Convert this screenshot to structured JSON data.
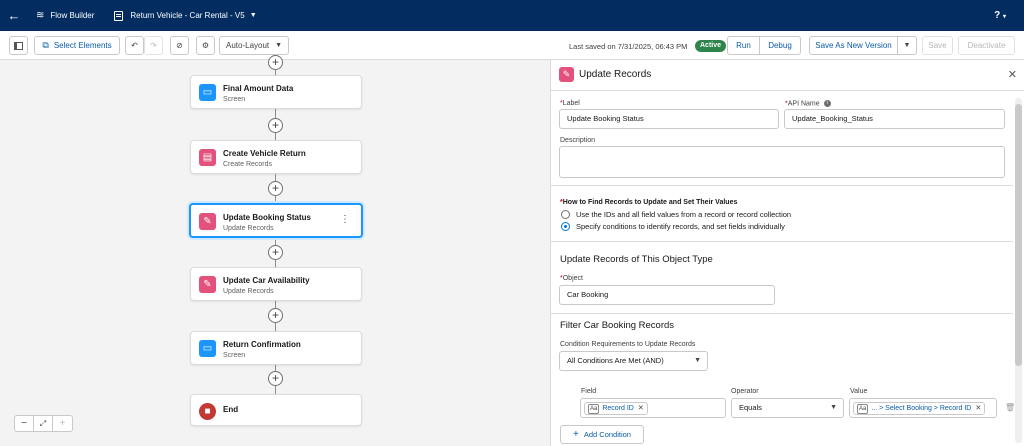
{
  "header": {
    "app_name": "Flow Builder",
    "flow_name": "Return Vehicle - Car Rental - V5",
    "help_label": "?"
  },
  "toolbar": {
    "select_elements": "Select Elements",
    "layout_mode": "Auto-Layout",
    "last_saved": "Last saved on 7/31/2025, 06:43 PM",
    "status_badge": "Active",
    "run": "Run",
    "debug": "Debug",
    "save_as": "Save As New Version",
    "save": "Save",
    "deactivate": "Deactivate"
  },
  "canvas": {
    "nodes": [
      {
        "title": "Final Amount Data",
        "type": "Screen",
        "icon": "screen-icon"
      },
      {
        "title": "Create Vehicle Return",
        "type": "Create Records",
        "icon": "record-create-icon"
      },
      {
        "title": "Update Booking Status",
        "type": "Update Records",
        "icon": "record-update-icon"
      },
      {
        "title": "Update Car Availability",
        "type": "Update Records",
        "icon": "record-update-icon"
      },
      {
        "title": "Return Confirmation",
        "type": "Screen",
        "icon": "screen-icon"
      },
      {
        "title": "End",
        "type": "",
        "icon": "stop-icon"
      }
    ]
  },
  "panel": {
    "title": "Update Records",
    "label_field": {
      "label": "Label",
      "value": "Update Booking Status"
    },
    "api_field": {
      "label": "API Name",
      "value": "Update_Booking_Status"
    },
    "description_label": "Description",
    "how_to_find": {
      "label": "How to Find Records to Update and Set Their Values",
      "options": [
        "Use the IDs and all field values from a record or record collection",
        "Specify conditions to identify records, and set fields individually"
      ],
      "selected_index": 1
    },
    "object_section": {
      "title": "Update Records of This Object Type",
      "object_label": "Object",
      "object_value": "Car Booking"
    },
    "filter_section": {
      "title": "Filter Car Booking Records",
      "cond_label": "Condition Requirements to Update Records",
      "cond_value": "All Conditions Are Met (AND)",
      "col_field": "Field",
      "col_operator": "Operator",
      "col_value": "Value",
      "row": {
        "field": "Record ID",
        "operator": "Equals",
        "value": "... > Select Booking > Record ID"
      },
      "add_condition": "Add Condition"
    }
  },
  "colors": {
    "header_bg": "#032d60",
    "active_badge": "#2e844a",
    "selected_border": "#1b96ff",
    "update_icon": "#e3517c",
    "screen_icon": "#1b96ff",
    "end_icon": "#c23934"
  }
}
